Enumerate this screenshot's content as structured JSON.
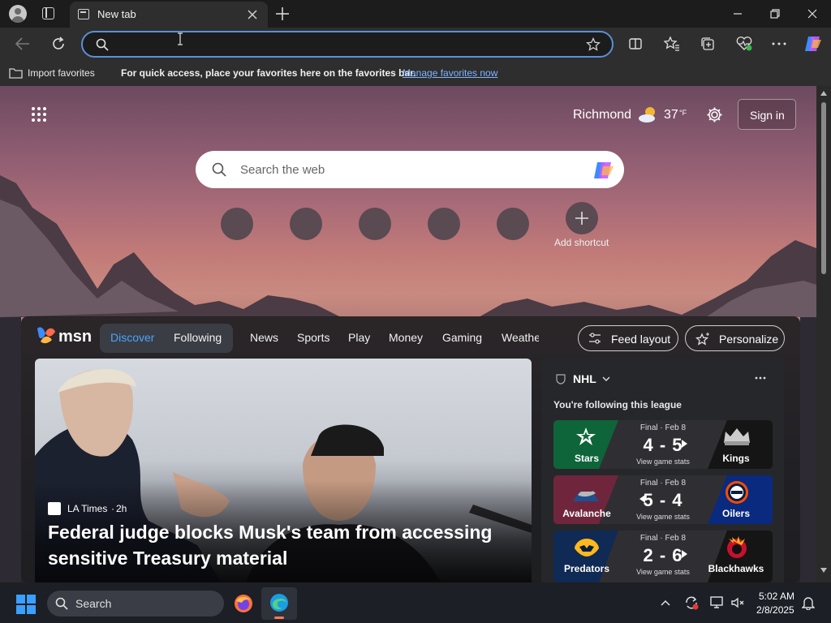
{
  "browser": {
    "tab_title": "New tab",
    "address_value": "",
    "favorites_bar": {
      "import_label": "Import favorites",
      "hint": "For quick access, place your favorites here on the favorites bar.",
      "manage_link": "Manage favorites now"
    }
  },
  "newtab": {
    "weather": {
      "city": "Richmond",
      "temp": "37",
      "unit": "°F"
    },
    "sign_in_label": "Sign in",
    "search_placeholder": "Search the web",
    "add_shortcut_label": "Add shortcut"
  },
  "feed": {
    "logo": "msn",
    "tabs": [
      "Discover",
      "Following"
    ],
    "nav": [
      "News",
      "Sports",
      "Play",
      "Money",
      "Gaming",
      "Weathe"
    ],
    "feed_layout_label": "Feed layout",
    "personalize_label": "Personalize",
    "hero": {
      "source": "LA Times",
      "age": "2h",
      "headline_line1": "Federal judge blocks Musk's team from accessing",
      "headline_line2": "sensitive Treasury material"
    },
    "sports": {
      "league": "NHL",
      "subtitle": "You're following this league",
      "games": [
        {
          "status": "Final · Feb 8",
          "home": "Stars",
          "away": "Kings",
          "score": "4 - 5",
          "stats": "View game stats",
          "home_color": "#0b6b3a",
          "away_color": "#1a1a1a"
        },
        {
          "status": "Final · Feb 8",
          "home": "Avalanche",
          "away": "Oilers",
          "score": "5 - 4",
          "stats": "View game stats",
          "home_color": "#6f263d",
          "away_color": "#0a2a80"
        },
        {
          "status": "Final · Feb 8",
          "home": "Predators",
          "away": "Blackhawks",
          "score": "2 - 6",
          "stats": "View game stats",
          "home_color": "#0f2a55",
          "away_color": "#1a1a1a"
        }
      ]
    }
  },
  "taskbar": {
    "search_placeholder": "Search",
    "time": "5:02 AM",
    "date": "2/8/2025"
  },
  "colors": {
    "accent": "#5b8fd8",
    "link": "#7fb4ff",
    "discover": "#4aa3ff"
  }
}
